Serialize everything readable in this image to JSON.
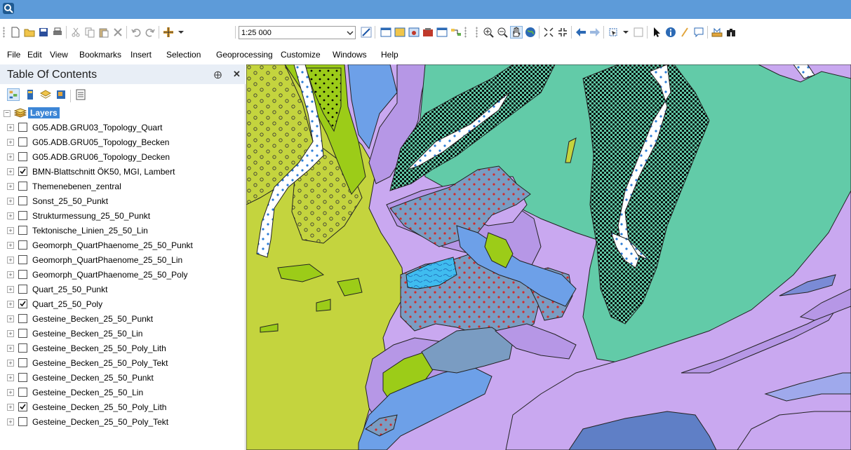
{
  "toolbar": {
    "scale_value": "1:25 000"
  },
  "menu": {
    "items": [
      "File",
      "Edit",
      "View",
      "Bookmarks",
      "Insert",
      "Selection",
      "Geoprocessing",
      "Customize",
      "Windows",
      "Help"
    ]
  },
  "toc": {
    "title": "Table Of Contents",
    "pin_glyph": "⨁",
    "close_glyph": "✕",
    "root_label": "Layers",
    "layers": [
      {
        "name": "G05.ADB.GRU03_Topology_Quart",
        "checked": false
      },
      {
        "name": "G05.ADB.GRU05_Topology_Becken",
        "checked": false
      },
      {
        "name": "G05.ADB.GRU06_Topology_Decken",
        "checked": false
      },
      {
        "name": "BMN-Blattschnitt ÖK50, MGI, Lambert",
        "checked": true
      },
      {
        "name": "Themenebenen_zentral",
        "checked": false
      },
      {
        "name": "Sonst_25_50_Punkt",
        "checked": false
      },
      {
        "name": "Strukturmessung_25_50_Punkt",
        "checked": false
      },
      {
        "name": "Tektonische_Linien_25_50_Lin",
        "checked": false
      },
      {
        "name": "Geomorph_QuartPhaenome_25_50_Punkt",
        "checked": false
      },
      {
        "name": "Geomorph_QuartPhaenome_25_50_Lin",
        "checked": false
      },
      {
        "name": "Geomorph_QuartPhaenome_25_50_Poly",
        "checked": false
      },
      {
        "name": "Quart_25_50_Punkt",
        "checked": false
      },
      {
        "name": "Quart_25_50_Poly",
        "checked": true
      },
      {
        "name": "Gesteine_Becken_25_50_Punkt",
        "checked": false
      },
      {
        "name": "Gesteine_Becken_25_50_Lin",
        "checked": false
      },
      {
        "name": "Gesteine_Becken_25_50_Poly_Lith",
        "checked": false
      },
      {
        "name": "Gesteine_Becken_25_50_Poly_Tekt",
        "checked": false
      },
      {
        "name": "Gesteine_Decken_25_50_Punkt",
        "checked": false
      },
      {
        "name": "Gesteine_Decken_25_50_Lin",
        "checked": false
      },
      {
        "name": "Gesteine_Decken_25_50_Poly_Lith",
        "checked": true
      },
      {
        "name": "Gesteine_Decken_25_50_Poly_Tekt",
        "checked": false
      }
    ]
  },
  "colors": {
    "titlebar": "#5d9bd9",
    "selection": "#3d86d6",
    "map_lilac": "#c9a8f0",
    "map_purple": "#b697e6",
    "map_green_teal": "#62cba8",
    "map_olive": "#c4d43e",
    "map_lime": "#9ccc18",
    "map_blue": "#6da0e8",
    "map_slate": "#7a9cc2",
    "map_dark_blue": "#5f7fc6",
    "map_light_blue": "#3fbcef"
  }
}
